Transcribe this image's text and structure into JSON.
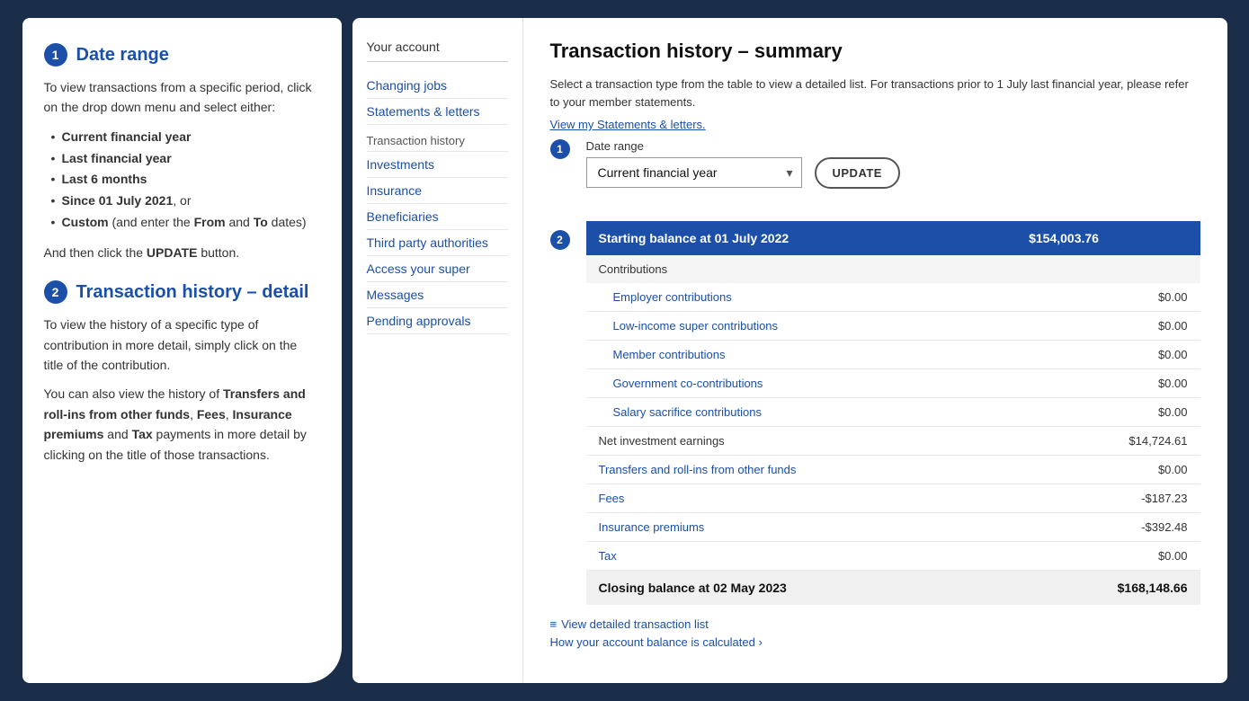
{
  "left": {
    "step1": {
      "number": "1",
      "title": "Date range",
      "para1": "To view transactions from a specific period, click on the drop down menu and select either:",
      "bullets": [
        "Current financial year",
        "Last financial year",
        "Last 6 months",
        "Since 01 July 2021, or",
        "Custom (and enter the From and To dates)"
      ],
      "bullet_bold": [
        true,
        true,
        true,
        true,
        true
      ],
      "para2_prefix": "And then click the ",
      "para2_bold": "UPDATE",
      "para2_suffix": " button."
    },
    "step2": {
      "number": "2",
      "title": "Transaction history – detail",
      "para1": "To view the history of a specific type of contribution in more detail, simply click on the title of the contribution.",
      "para2_prefix": "You can also view the history of ",
      "para2_bold1": "Transfers and roll-ins from other funds",
      "para2_mid": ", ",
      "para2_bold2": "Fees",
      "para2_mid2": ", ",
      "para2_bold3": "Insurance premiums",
      "para2_mid3": " and ",
      "para2_bold4": "Tax",
      "para2_suffix": " payments in more detail by clicking on the title of those transactions."
    }
  },
  "sidebar": {
    "account_label": "Your account",
    "links": [
      {
        "label": "Changing jobs",
        "has_border_bottom": true
      },
      {
        "label": "Statements & letters",
        "has_border_bottom": true
      }
    ],
    "section_label": "Transaction history",
    "sub_links": [
      {
        "label": "Investments"
      },
      {
        "label": "Insurance"
      },
      {
        "label": "Beneficiaries"
      },
      {
        "label": "Third party authorities"
      },
      {
        "label": "Access your super"
      },
      {
        "label": "Messages"
      },
      {
        "label": "Pending approvals"
      }
    ]
  },
  "main": {
    "title": "Transaction history – summary",
    "description": "Select a transaction type from the table to view a detailed list. For transactions prior to 1 July last financial year, please refer to your member statements.",
    "statements_link": "View my Statements & letters.",
    "date_range_label": "Date range",
    "date_range_value": "Current financial year",
    "date_range_options": [
      "Current financial year",
      "Last financial year",
      "Last 6 months",
      "Since 01 July 2021",
      "Custom"
    ],
    "update_button": "UPDATE",
    "table": {
      "header": {
        "label": "Starting balance at 01 July 2022",
        "value": "$154,003.76"
      },
      "contributions_label": "Contributions",
      "rows": [
        {
          "label": "Employer contributions",
          "value": "$0.00",
          "is_link": true
        },
        {
          "label": "Low-income super contributions",
          "value": "$0.00",
          "is_link": true
        },
        {
          "label": "Member contributions",
          "value": "$0.00",
          "is_link": true
        },
        {
          "label": "Government co-contributions",
          "value": "$0.00",
          "is_link": true
        },
        {
          "label": "Salary sacrifice contributions",
          "value": "$0.00",
          "is_link": true
        }
      ],
      "plain_rows": [
        {
          "label": "Net investment earnings",
          "value": "$14,724.61",
          "is_link": false
        },
        {
          "label": "Transfers and roll-ins from other funds",
          "value": "$0.00",
          "is_link": true
        },
        {
          "label": "Fees",
          "value": "-$187.23",
          "is_link": true
        },
        {
          "label": "Insurance premiums",
          "value": "-$392.48",
          "is_link": true
        },
        {
          "label": "Tax",
          "value": "$0.00",
          "is_link": true
        }
      ],
      "footer": {
        "label": "Closing balance at 02 May 2023",
        "value": "$168,148.66"
      }
    },
    "footer_links": [
      {
        "icon": "≡",
        "label": "View detailed transaction list"
      },
      {
        "icon": "",
        "label": "How your account balance is calculated ›"
      }
    ]
  }
}
